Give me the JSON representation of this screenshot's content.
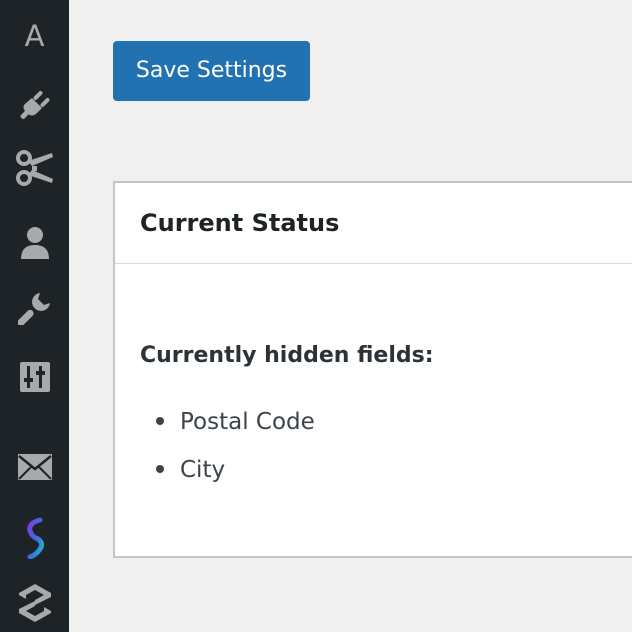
{
  "sidebar": {
    "items": [
      {
        "id": "a",
        "icon": "letter-a-icon",
        "glyph": "A"
      },
      {
        "id": "plugins",
        "icon": "plug-icon"
      },
      {
        "id": "tools-scissors",
        "icon": "scissors-icon"
      },
      {
        "id": "users",
        "icon": "user-icon"
      },
      {
        "id": "tools",
        "icon": "wrench-icon"
      },
      {
        "id": "settings",
        "icon": "sliders-icon"
      },
      {
        "id": "mail",
        "icon": "envelope-icon"
      },
      {
        "id": "plugin-s-gradient",
        "icon": "s-logo-gradient-icon"
      },
      {
        "id": "plugin-s-grey",
        "icon": "s-logo-icon"
      }
    ]
  },
  "toolbar": {
    "save_label": "Save Settings"
  },
  "status_card": {
    "title": "Current Status",
    "hidden_label": "Currently hidden fields:",
    "hidden_fields": [
      "Postal Code",
      "City"
    ]
  },
  "colors": {
    "sidebar_bg": "#1d2327",
    "sidebar_icon": "#a7aaad",
    "primary_button": "#2271b1",
    "page_bg": "#f0f0f1"
  }
}
